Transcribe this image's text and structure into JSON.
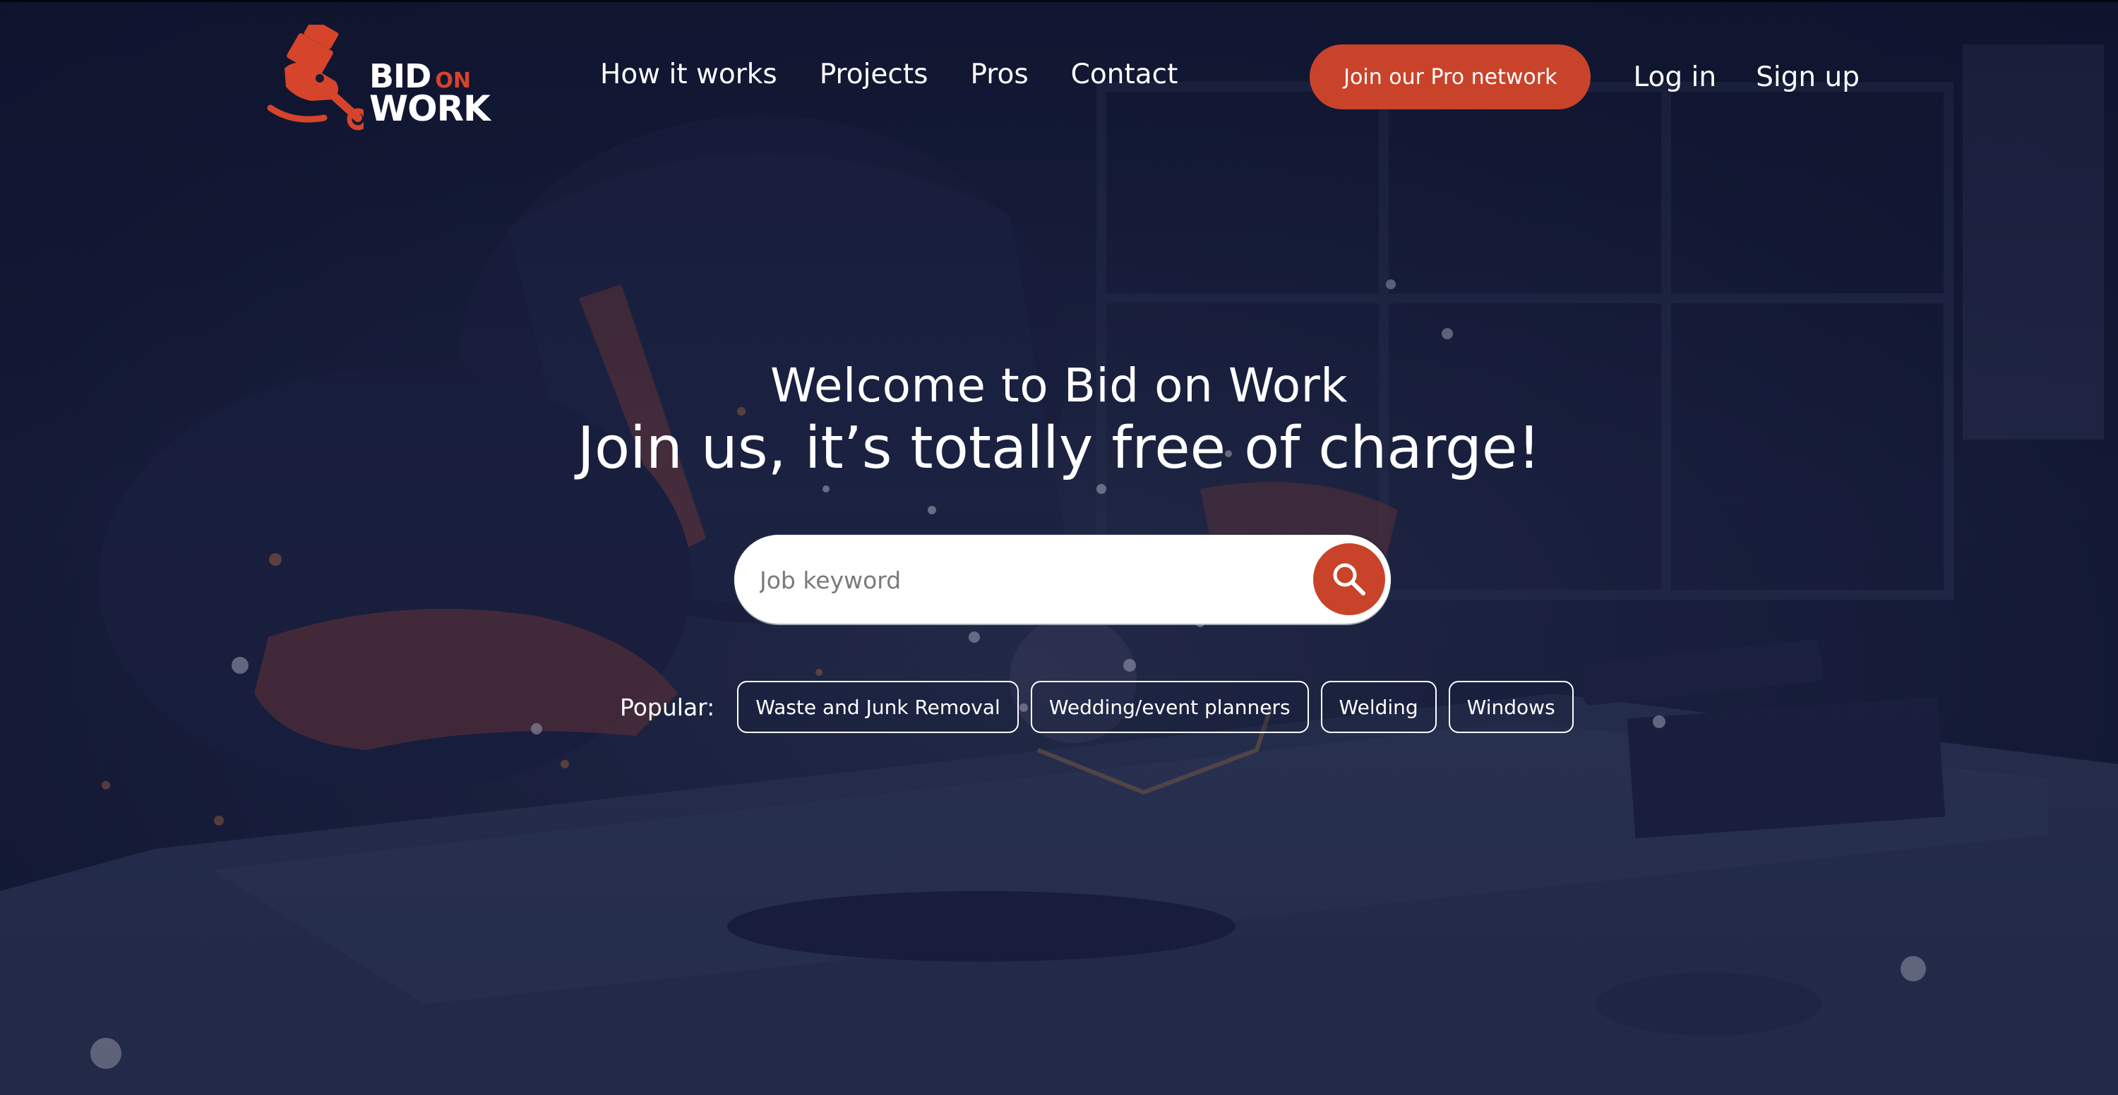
{
  "brand": {
    "name_line1": "BID",
    "name_on": "ON",
    "name_line2": "WORK",
    "accent_color": "#c9432b"
  },
  "nav": {
    "items": [
      {
        "label": "How it works"
      },
      {
        "label": "Projects"
      },
      {
        "label": "Pros"
      },
      {
        "label": "Contact"
      }
    ]
  },
  "auth": {
    "pro_button": "Join our Pro network",
    "login": "Log in",
    "signup": "Sign up"
  },
  "hero": {
    "welcome": "Welcome to Bid on Work",
    "tagline": "Join us, it’s totally free of charge!",
    "search_placeholder": "Job keyword",
    "search_value": "",
    "search_icon": "search-icon"
  },
  "popular": {
    "label": "Popular:",
    "chips": [
      {
        "label": "Waste and Junk Removal"
      },
      {
        "label": "Wedding/event planners"
      },
      {
        "label": "Welding"
      },
      {
        "label": "Windows"
      }
    ]
  }
}
